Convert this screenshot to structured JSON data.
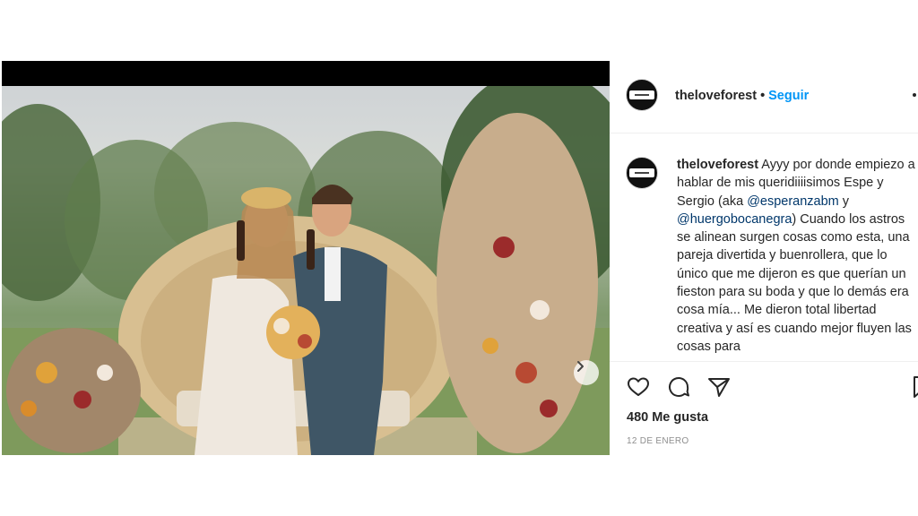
{
  "post": {
    "username": "theloveforest",
    "follow_label": "Seguir",
    "separator": "•",
    "caption_username": "theloveforest",
    "caption_part1": " Ayyy por donde empiezo a hablar de mis queridiiiisimos Espe y Sergio (aka ",
    "mention1": "@esperanzabm",
    "caption_and": " y ",
    "mention2": "@huergobocanegra",
    "caption_part2": ") Cuando los astros se alinean surgen cosas como esta, una pareja divertida y buenrollera, que lo único que me dijeron es que querían un fieston para su boda y que lo demás era cosa mía... Me dieron total libertad creativa y así es cuando mejor fluyen las cosas para",
    "likes": "480 Me gusta",
    "date": "12 DE ENERO"
  },
  "icons": {
    "like": "heart-icon",
    "comment": "comment-icon",
    "share": "paper-plane-icon",
    "save": "bookmark-icon",
    "next": "chevron-right-icon",
    "more": "more-options-icon"
  },
  "colors": {
    "follow": "#0095f6",
    "mention": "#00376b",
    "meta": "#8e8e8e",
    "text": "#262626"
  }
}
